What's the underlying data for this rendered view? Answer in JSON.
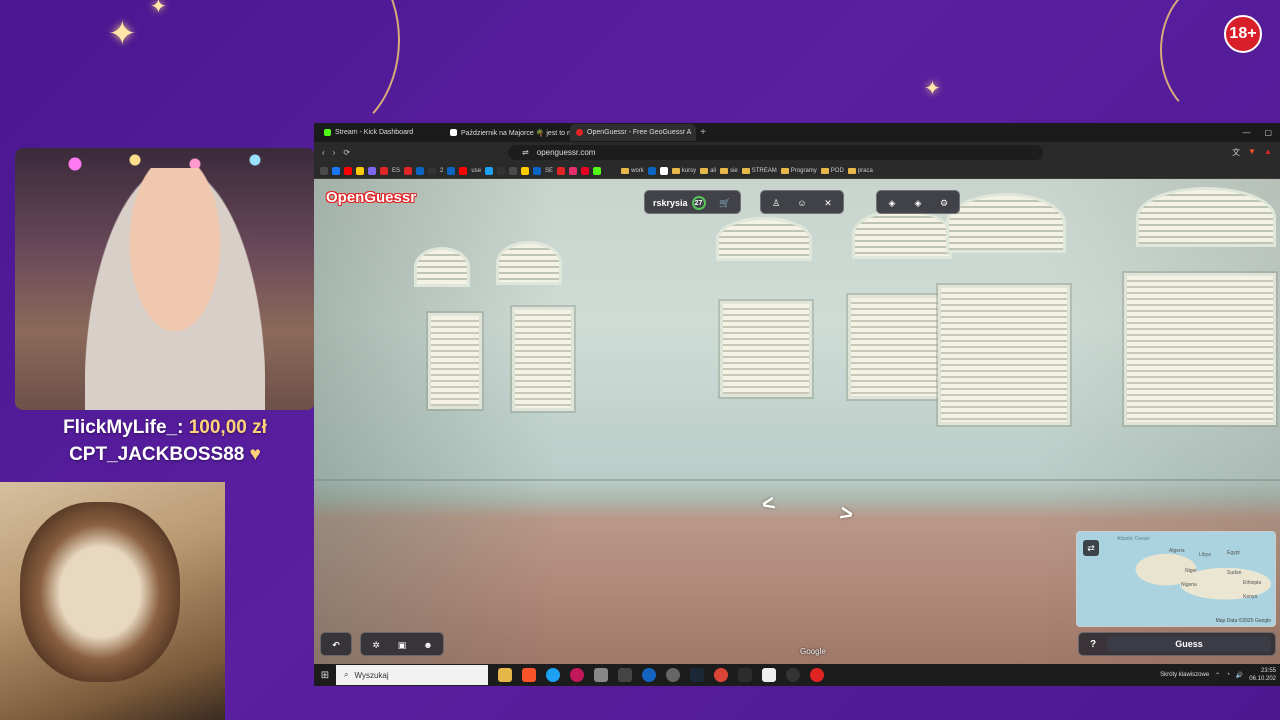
{
  "overlay": {
    "age_badge": "18+",
    "donation_line": {
      "name": "FlickMyLife_:",
      "amount": "100,00 zł"
    },
    "sub_line": {
      "name": "CPT_JACKBOSS88",
      "heart": "♥"
    }
  },
  "browser": {
    "tabs": [
      {
        "label": "Stream - Kick Dashboard",
        "color": "#53fc18"
      },
      {
        "label": "Październik na Majorce 🌴 jest to na",
        "color": "#ffffff"
      },
      {
        "label": "OpenGuessr - Free GeoGuessr A",
        "color": "#e02424",
        "active": true
      }
    ],
    "new_tab": "+",
    "url": "openguessr.com",
    "bookmarks": {
      "items": [
        "ES",
        "2",
        "SE",
        "use"
      ],
      "folders": [
        "work",
        "kursy",
        "ali",
        "sie",
        "STREAM",
        "Programy",
        "POD",
        "praca"
      ]
    }
  },
  "game": {
    "logo": "OpenGuessr",
    "username": "rskrysia",
    "level": "27",
    "google_label": "Google",
    "minimap_credit": "Map Data ©2025 Google",
    "minimap_labels": [
      "Atlantic Ocean",
      "Algeria",
      "Libya",
      "Egypt",
      "Niger",
      "Sudan",
      "Nigeria",
      "Ethiopia",
      "Kenya"
    ],
    "help_label": "?",
    "guess_label": "Guess"
  },
  "taskbar": {
    "search_placeholder": "Wyszukaj",
    "time": "23:55",
    "date": "06.10.202",
    "tray_note": "Skróty klawiszowe"
  },
  "icons": {
    "back": "back-arrow-icon",
    "reload": "reload-icon",
    "cart": "cart-icon",
    "undo": "undo-icon",
    "settings": "settings-icon"
  }
}
